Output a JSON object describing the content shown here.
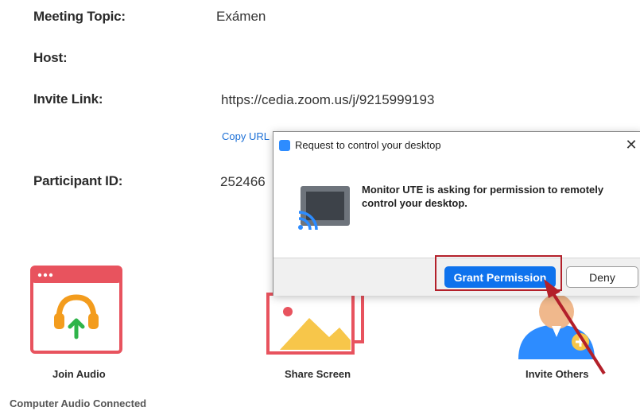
{
  "meeting": {
    "topic_label": "Meeting Topic:",
    "topic_value": "Exámen",
    "host_label": "Host:",
    "invite_label": "Invite Link:",
    "invite_value": "https://cedia.zoom.us/j/9215999193",
    "copy_url": "Copy URL",
    "participant_label": "Participant ID:",
    "participant_value": "252466"
  },
  "tiles": {
    "join_audio": "Join Audio",
    "share_screen": "Share Screen",
    "invite_others": "Invite Others"
  },
  "status": "Computer Audio Connected",
  "dialog": {
    "title": "Request to control your desktop",
    "close": "✕",
    "message": "Monitor UTE is asking for permission to remotely control your desktop.",
    "grant_label": "Grant Permission",
    "deny_label": "Deny"
  },
  "colors": {
    "accent_blue": "#0e72ed",
    "tile_red": "#e8535e",
    "highlight_red": "#b3202a"
  }
}
